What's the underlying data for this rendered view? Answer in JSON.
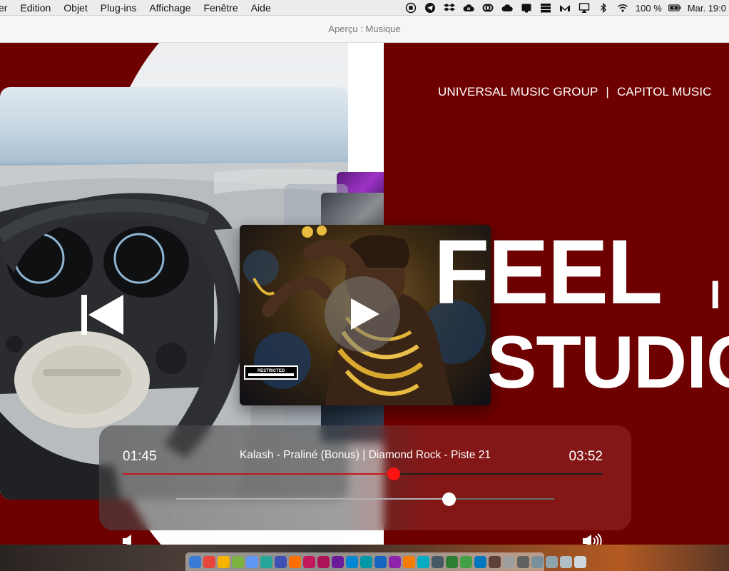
{
  "menubar": {
    "menus": [
      "er",
      "Edition",
      "Objet",
      "Plug-ins",
      "Affichage",
      "Fenêtre",
      "Aide"
    ],
    "battery": "100 %",
    "clock": "Mar. 19:0"
  },
  "window": {
    "title": "Aperçu : Musique"
  },
  "page": {
    "labels": {
      "left": "UNIVERSAL MUSIC GROUP",
      "separator": "|",
      "right": "CAPITOL MUSIC"
    },
    "headline_line1": "FEEL",
    "headline_fragment": "I",
    "headline_line2": "STUDIO",
    "colors": {
      "background": "#6e0000",
      "accent": "#ff1414"
    }
  },
  "player": {
    "current_time": "01:45",
    "total_time": "03:52",
    "track_title": "Kalash - Praliné (Bonus) | Diamond Rock - Piste 21",
    "progress": 0.565,
    "volume": 0.72
  },
  "album": {
    "badge_text": "RESTRICTED"
  },
  "icons": {
    "prev": "previous-track-icon",
    "play": "play-icon",
    "vol_low": "volume-low-icon",
    "vol_high": "volume-high-icon"
  }
}
